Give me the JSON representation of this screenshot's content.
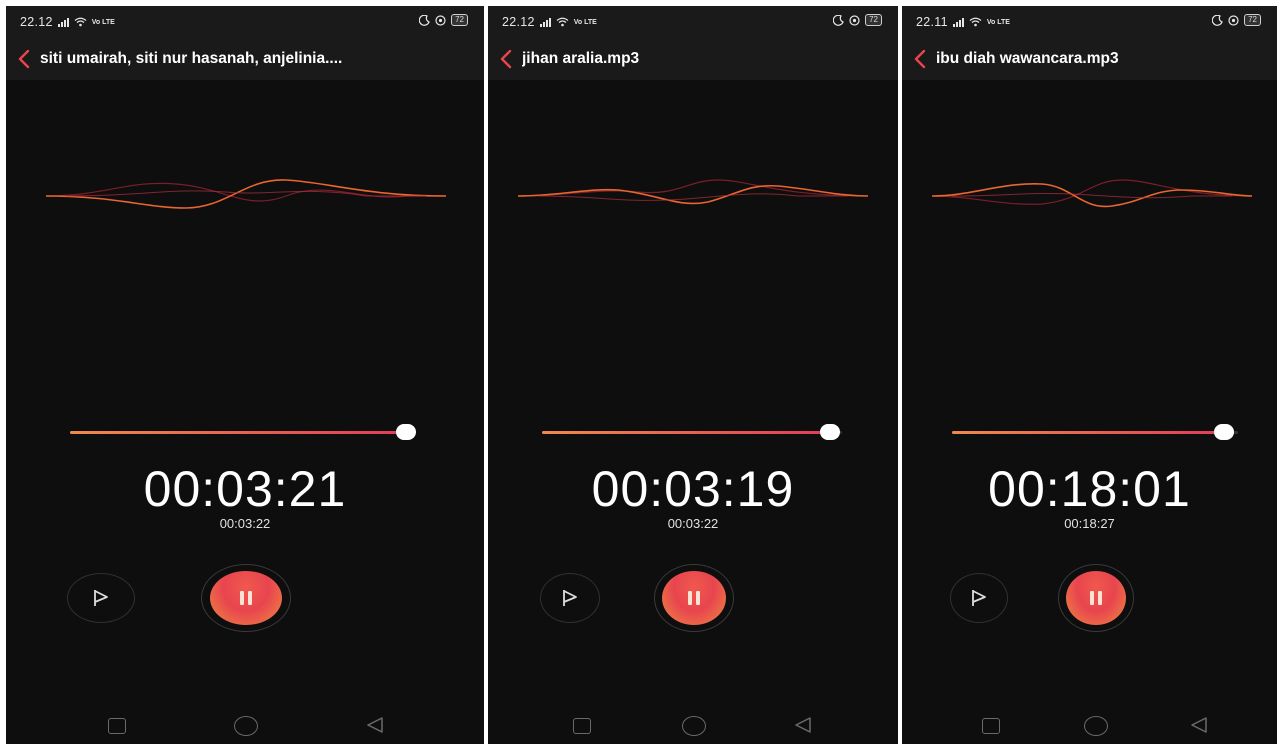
{
  "screens": [
    {
      "status": {
        "time": "22.12",
        "volte": "Vo LTE",
        "battery": "72"
      },
      "title": "siti umairah, siti nur hasanah, anjelinia....",
      "elapsed": "00:03:21",
      "total": "00:03:22",
      "progress": 0.995
    },
    {
      "status": {
        "time": "22.12",
        "volte": "Vo LTE",
        "battery": "72"
      },
      "title": "jihan aralia.mp3",
      "elapsed": "00:03:19",
      "total": "00:03:22",
      "progress": 0.985
    },
    {
      "status": {
        "time": "22.11",
        "volte": "Vo LTE",
        "battery": "72"
      },
      "title": "ibu diah wawancara.mp3",
      "elapsed": "00:18:01",
      "total": "00:18:27",
      "progress": 0.976
    }
  ],
  "colors": {
    "accent": "#e8454f",
    "accent2": "#f08a40",
    "background": "#0e0e0e",
    "bar": "#1a1a1a"
  },
  "icons": [
    "back-icon",
    "flag-icon",
    "pause-icon",
    "wifi-icon",
    "signal-icon",
    "moon-icon",
    "alarm-icon",
    "battery-icon"
  ]
}
